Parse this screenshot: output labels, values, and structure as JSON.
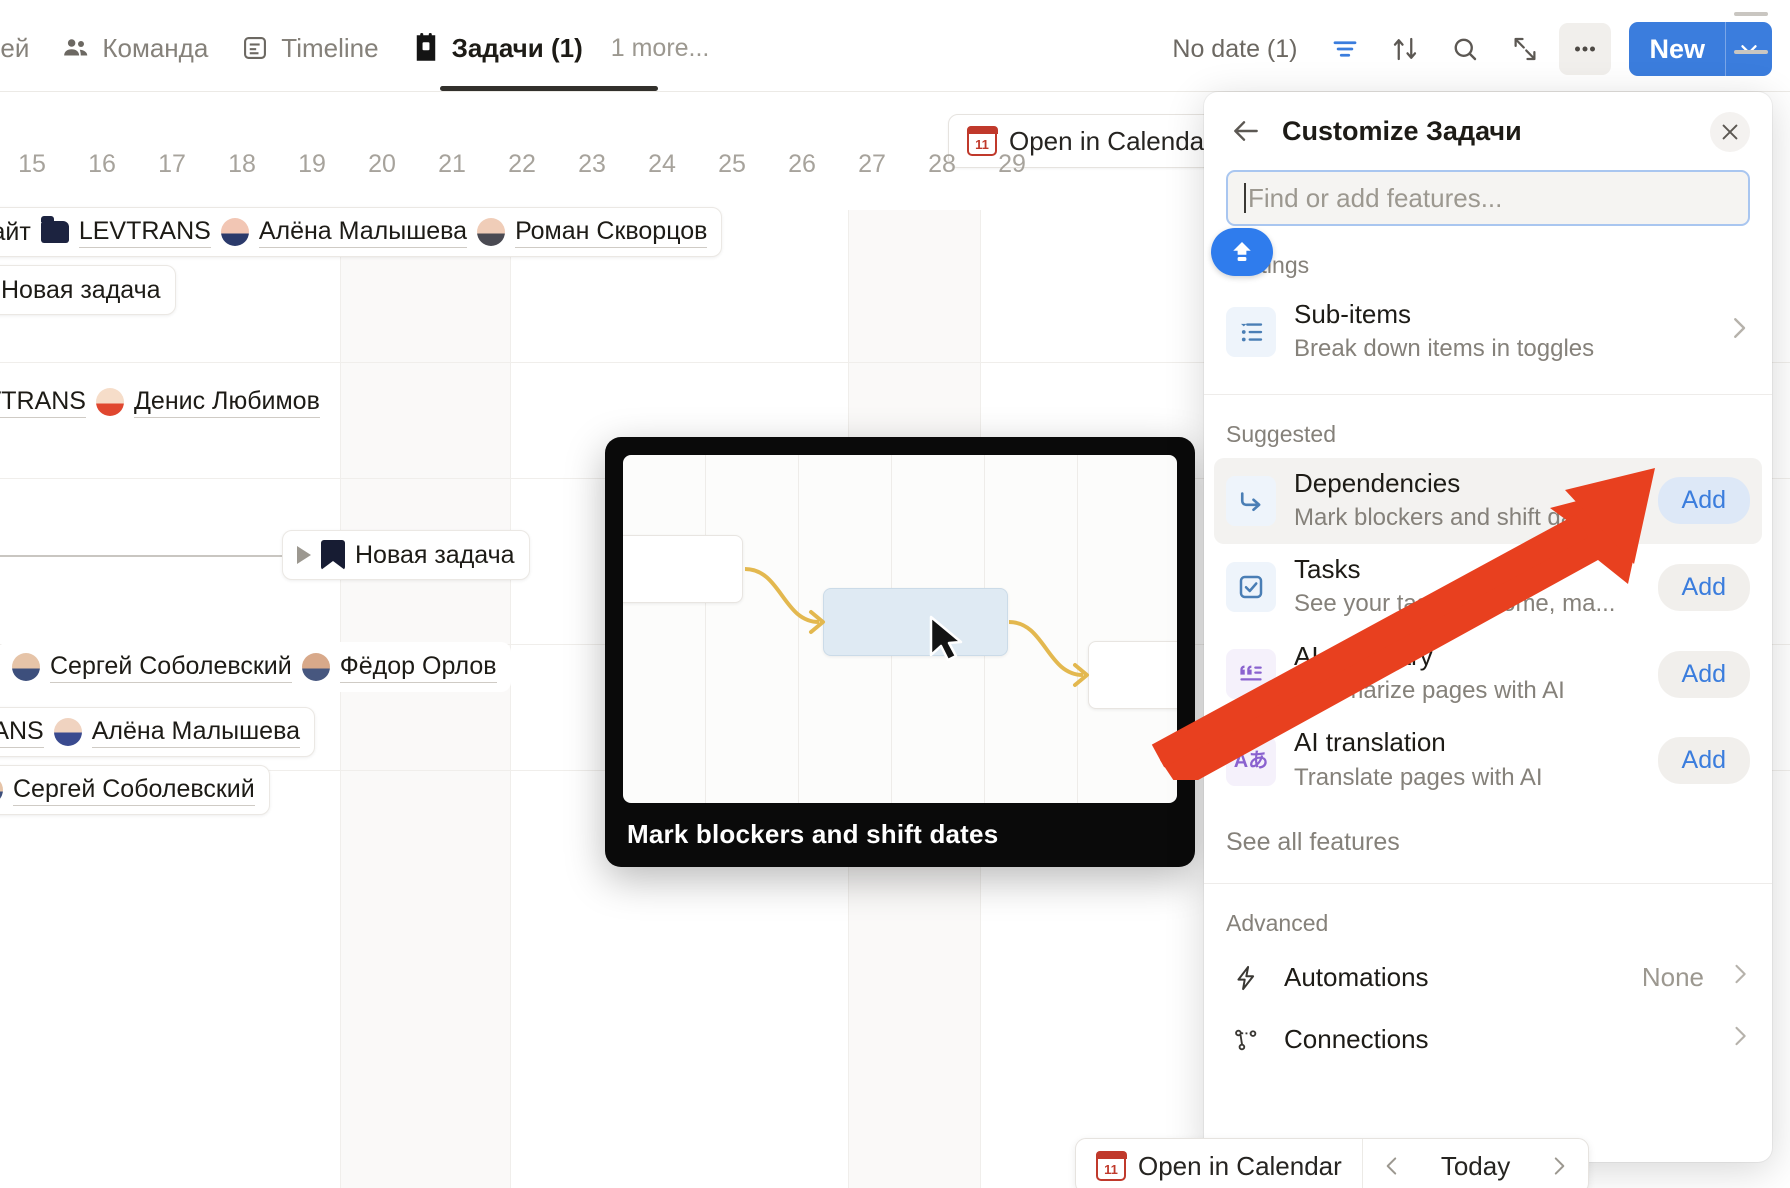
{
  "tabs": [
    {
      "label": "ней",
      "icon": "",
      "active": false
    },
    {
      "label": "Команда",
      "icon": "people-icon",
      "active": false
    },
    {
      "label": "Timeline",
      "icon": "timeline-icon",
      "active": false
    },
    {
      "label": "Задачи (1)",
      "icon": "tasks-icon",
      "active": true
    }
  ],
  "tab_more": "1 more...",
  "toolbar": {
    "no_date": "No date (1)",
    "filter_icon": "filter-icon",
    "sort_icon": "sort-icon",
    "search_icon": "search-icon",
    "expand_icon": "expand-icon",
    "more_icon": "more-horizontal-icon",
    "new_label": "New",
    "new_caret_icon": "chevron-down-icon"
  },
  "timeline": {
    "open_in_calendar": "Open in Calendar",
    "calendar_icon": "calendar-icon",
    "calendar_day": "11",
    "days": [
      "15",
      "16",
      "17",
      "18",
      "19",
      "20",
      "21",
      "22",
      "23",
      "24",
      "25",
      "26",
      "27",
      "28",
      "29"
    ],
    "chips": [
      {
        "text_prefix": "сайт",
        "folder": "LEVTRANS",
        "people": [
          "Алёна Малышева",
          "Роман Скворцов"
        ]
      },
      {
        "text": "Новая задача"
      },
      {
        "folder": "LEVTRANS",
        "people": [
          "Денис Любимов"
        ]
      },
      {
        "text": "Новая задача"
      },
      {
        "people": [
          "Сергей Соболевский",
          "Фёдор Орлов"
        ]
      },
      {
        "folder": "TRANS",
        "people": [
          "Алёна Малышева"
        ]
      },
      {
        "people": [
          "Сергей Соболевский"
        ]
      }
    ]
  },
  "preview": {
    "caption": "Mark blockers and shift dates"
  },
  "panel": {
    "back_icon": "back-arrow-icon",
    "title": "Customize Задачи",
    "close_icon": "close-icon",
    "search_placeholder": "Find or add features...",
    "search_value": "",
    "badge_icon": "upgrade-icon",
    "sections": [
      {
        "label": "Settings",
        "items": [
          {
            "icon": "sub-items-icon",
            "title": "Sub-items",
            "subtitle": "Break down items in toggles",
            "action": "chevron",
            "action_label": "",
            "highlighted": false
          }
        ]
      },
      {
        "label": "Suggested",
        "items": [
          {
            "icon": "dependencies-icon",
            "title": "Dependencies",
            "subtitle": "Mark blockers and shift dates",
            "action": "add",
            "action_label": "Add",
            "highlighted": true
          },
          {
            "icon": "tasks-check-icon",
            "title": "Tasks",
            "subtitle": "See your tasks in Home, ma...",
            "action": "add",
            "action_label": "Add",
            "highlighted": false
          },
          {
            "icon": "ai-summary-icon",
            "title": "AI summary",
            "subtitle": "Summarize pages with AI",
            "action": "add",
            "action_label": "Add",
            "highlighted": false
          },
          {
            "icon": "ai-translation-icon",
            "title": "AI translation",
            "subtitle": "Translate pages with AI",
            "action": "add",
            "action_label": "Add",
            "highlighted": false
          }
        ]
      }
    ],
    "see_all": "See all features",
    "advanced_label": "Advanced",
    "advanced": [
      {
        "icon": "lightning-icon",
        "label": "Automations",
        "value": "None"
      },
      {
        "icon": "connections-icon",
        "label": "Connections",
        "value": ""
      }
    ]
  },
  "bottombar": {
    "calendar_icon": "calendar-icon",
    "calendar_day": "11",
    "open_in_calendar": "Open in Calendar",
    "prev_icon": "chevron-left-icon",
    "today": "Today",
    "next_icon": "chevron-right-icon"
  },
  "colors": {
    "accent_blue": "#3b7ddd",
    "annotation_red": "#e8401f",
    "dependency_yellow": "#e3b84f",
    "panel_bg": "#ffffff"
  }
}
